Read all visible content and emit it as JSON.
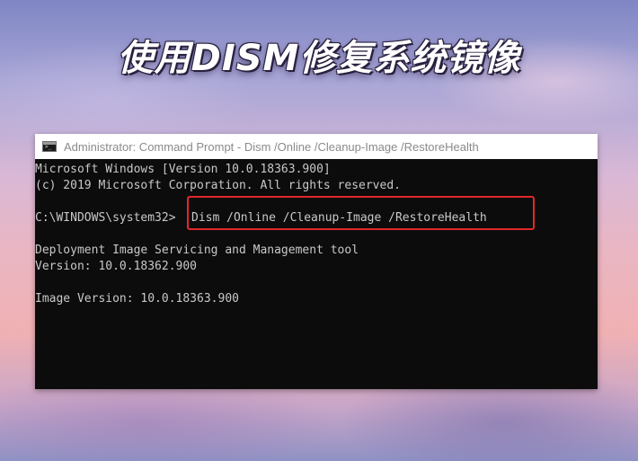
{
  "banner": {
    "title": "使用DISM修复系统镜像"
  },
  "window": {
    "title": "Administrator: Command Prompt - Dism  /Online /Cleanup-Image /RestoreHealth",
    "icon": "command-prompt-icon"
  },
  "console": {
    "lines": [
      "Microsoft Windows [Version 10.0.18363.900]",
      "(c) 2019 Microsoft Corporation. All rights reserved.",
      "C:\\WINDOWS\\system32>",
      "Deployment Image Servicing and Management tool",
      "Version: 10.0.18362.900",
      "Image Version: 10.0.18363.900"
    ],
    "command": "Dism /Online /Cleanup-Image /RestoreHealth"
  },
  "colors": {
    "console_bg": "#0c0c0c",
    "console_text": "#c8c8c8",
    "highlight": "#e0282a"
  }
}
